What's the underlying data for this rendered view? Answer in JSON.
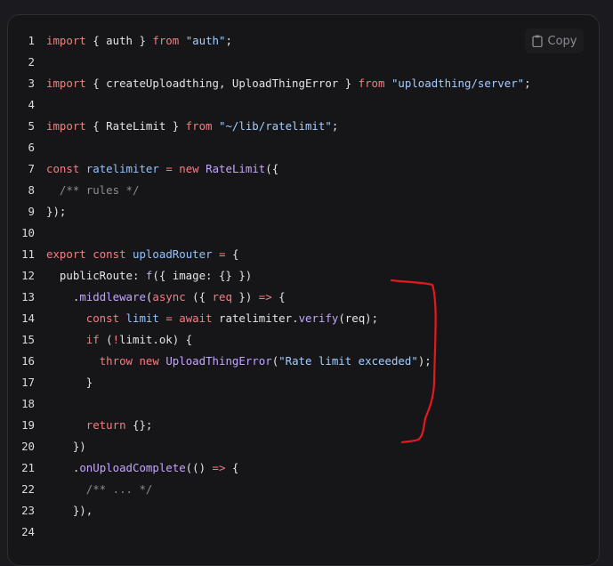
{
  "copy_button": {
    "label": "Copy",
    "icon": "clipboard-icon"
  },
  "annotation": {
    "color": "#e5181e",
    "shape": "hand-drawn-bracket"
  },
  "colors": {
    "keyword": "#f87c84",
    "string": "#a4cdff",
    "identifier": "#93c3fd",
    "function": "#c3a6fe",
    "comment": "#8b8b93",
    "plain": "#e4e4e7"
  },
  "code": {
    "lines": [
      {
        "n": "1",
        "tokens": [
          [
            "kw",
            "import"
          ],
          [
            "p",
            " { auth } "
          ],
          [
            "kw",
            "from"
          ],
          [
            "p",
            " "
          ],
          [
            "str",
            "\"auth\""
          ],
          [
            "p",
            ";"
          ]
        ]
      },
      {
        "n": "2",
        "tokens": []
      },
      {
        "n": "3",
        "tokens": [
          [
            "kw",
            "import"
          ],
          [
            "p",
            " { createUploadthing, UploadThingError } "
          ],
          [
            "kw",
            "from"
          ],
          [
            "p",
            " "
          ],
          [
            "str",
            "\"uploadthing/server\""
          ],
          [
            "p",
            ";"
          ]
        ]
      },
      {
        "n": "4",
        "tokens": []
      },
      {
        "n": "5",
        "tokens": [
          [
            "kw",
            "import"
          ],
          [
            "p",
            " { RateLimit } "
          ],
          [
            "kw",
            "from"
          ],
          [
            "p",
            " "
          ],
          [
            "str",
            "\"~/lib/ratelimit\""
          ],
          [
            "p",
            ";"
          ]
        ]
      },
      {
        "n": "6",
        "tokens": []
      },
      {
        "n": "7",
        "tokens": [
          [
            "kw",
            "const"
          ],
          [
            "p",
            " "
          ],
          [
            "id",
            "ratelimiter"
          ],
          [
            "p",
            " "
          ],
          [
            "kw",
            "="
          ],
          [
            "p",
            " "
          ],
          [
            "kw",
            "new"
          ],
          [
            "p",
            " "
          ],
          [
            "fn",
            "RateLimit"
          ],
          [
            "p",
            "({"
          ]
        ]
      },
      {
        "n": "8",
        "tokens": [
          [
            "p",
            "  "
          ],
          [
            "cm",
            "/** rules */"
          ]
        ]
      },
      {
        "n": "9",
        "tokens": [
          [
            "p",
            "});"
          ]
        ]
      },
      {
        "n": "10",
        "tokens": []
      },
      {
        "n": "11",
        "tokens": [
          [
            "kw",
            "export"
          ],
          [
            "p",
            " "
          ],
          [
            "kw",
            "const"
          ],
          [
            "p",
            " "
          ],
          [
            "id",
            "uploadRouter"
          ],
          [
            "p",
            " "
          ],
          [
            "kw",
            "="
          ],
          [
            "p",
            " {"
          ]
        ]
      },
      {
        "n": "12",
        "tokens": [
          [
            "p",
            "  publicRoute: "
          ],
          [
            "fn",
            "f"
          ],
          [
            "p",
            "({ image: {} })"
          ]
        ]
      },
      {
        "n": "13",
        "tokens": [
          [
            "p",
            "    ."
          ],
          [
            "fn",
            "middleware"
          ],
          [
            "p",
            "("
          ],
          [
            "kw",
            "async"
          ],
          [
            "p",
            " ({ "
          ],
          [
            "kw",
            "req"
          ],
          [
            "p",
            " }) "
          ],
          [
            "kw",
            "=>"
          ],
          [
            "p",
            " {"
          ]
        ]
      },
      {
        "n": "14",
        "tokens": [
          [
            "p",
            "      "
          ],
          [
            "kw",
            "const"
          ],
          [
            "p",
            " "
          ],
          [
            "id",
            "limit"
          ],
          [
            "p",
            " "
          ],
          [
            "kw",
            "="
          ],
          [
            "p",
            " "
          ],
          [
            "kw",
            "await"
          ],
          [
            "p",
            " ratelimiter."
          ],
          [
            "fn",
            "verify"
          ],
          [
            "p",
            "(req);"
          ]
        ]
      },
      {
        "n": "15",
        "tokens": [
          [
            "p",
            "      "
          ],
          [
            "kw",
            "if"
          ],
          [
            "p",
            " ("
          ],
          [
            "kw",
            "!"
          ],
          [
            "p",
            "limit.ok) {"
          ]
        ]
      },
      {
        "n": "16",
        "tokens": [
          [
            "p",
            "        "
          ],
          [
            "kw",
            "throw"
          ],
          [
            "p",
            " "
          ],
          [
            "kw",
            "new"
          ],
          [
            "p",
            " "
          ],
          [
            "fn",
            "UploadThingError"
          ],
          [
            "p",
            "("
          ],
          [
            "str",
            "\"Rate limit exceeded\""
          ],
          [
            "p",
            ");"
          ]
        ]
      },
      {
        "n": "17",
        "tokens": [
          [
            "p",
            "      }"
          ]
        ]
      },
      {
        "n": "18",
        "tokens": []
      },
      {
        "n": "19",
        "tokens": [
          [
            "p",
            "      "
          ],
          [
            "kw",
            "return"
          ],
          [
            "p",
            " {};"
          ]
        ]
      },
      {
        "n": "20",
        "tokens": [
          [
            "p",
            "    })"
          ]
        ]
      },
      {
        "n": "21",
        "tokens": [
          [
            "p",
            "    ."
          ],
          [
            "fn",
            "onUploadComplete"
          ],
          [
            "p",
            "(() "
          ],
          [
            "kw",
            "=>"
          ],
          [
            "p",
            " {"
          ]
        ]
      },
      {
        "n": "22",
        "tokens": [
          [
            "p",
            "      "
          ],
          [
            "cm",
            "/** ... */"
          ]
        ]
      },
      {
        "n": "23",
        "tokens": [
          [
            "p",
            "    }),"
          ]
        ]
      },
      {
        "n": "24",
        "tokens": []
      }
    ]
  }
}
